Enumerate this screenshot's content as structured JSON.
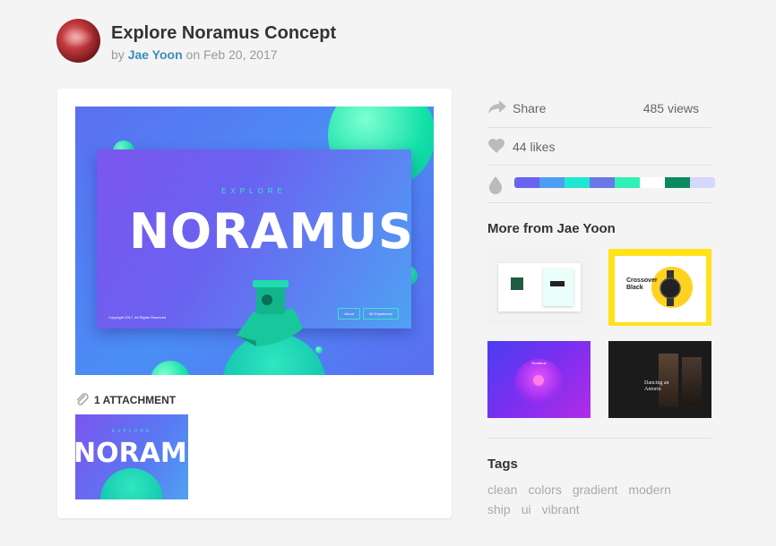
{
  "header": {
    "title": "Explore Noramus Concept",
    "by_label": "by",
    "author": "Jae Yoon",
    "on_label": "on",
    "date": "Feb 20, 2017"
  },
  "shot": {
    "kicker": "EXPLORE",
    "wordmark": "NORAMUS",
    "copyright": "Copyright 2017. All Rights Reserved",
    "buttons": [
      "About",
      "3D Experience"
    ]
  },
  "attachments": {
    "label": "1 ATTACHMENT",
    "thumb_kicker": "EXPLORE",
    "thumb_wordmark": "NORAMUS"
  },
  "stats": {
    "share_label": "Share",
    "views": "485 views",
    "likes": "44 likes"
  },
  "palette": [
    "#6a63ee",
    "#4d9ef3",
    "#1fe7d2",
    "#6b78e8",
    "#2ff0b6",
    "#ffffff",
    "#0c8a5f",
    "#d4d8fb"
  ],
  "more": {
    "title": "More from Jae Yoon",
    "thumb2_text": "Crossover Black",
    "thumb3_text": "Noramus",
    "thumb4_text": "Dancing an Antorm"
  },
  "tags": {
    "title": "Tags",
    "items": [
      "clean",
      "colors",
      "gradient",
      "modern",
      "ship",
      "ui",
      "vibrant"
    ]
  },
  "colors": {
    "accent_link": "#3a8bbb",
    "mint": "#35e8c7"
  }
}
